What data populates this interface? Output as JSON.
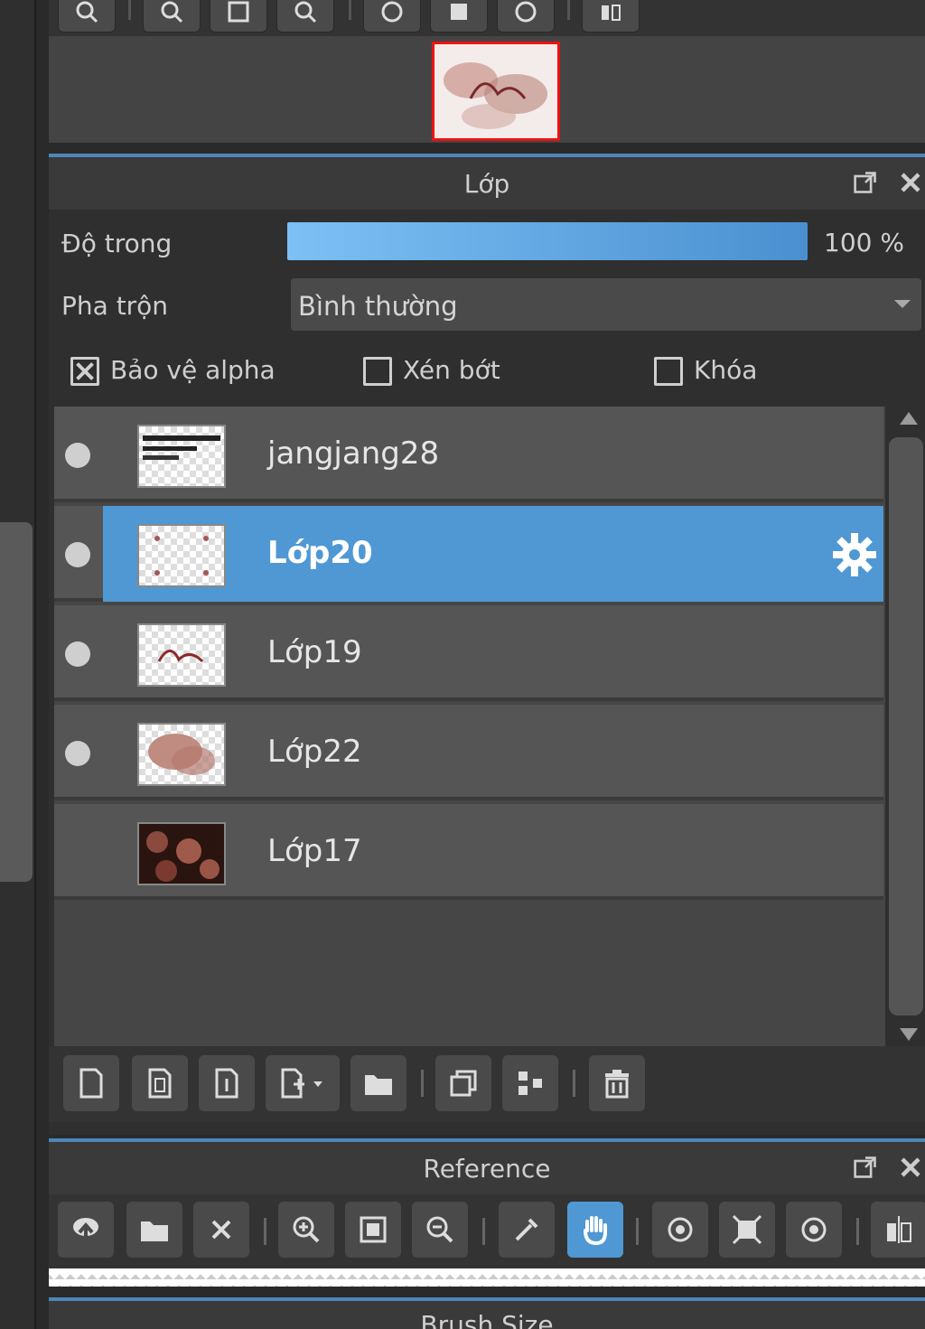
{
  "layer_panel": {
    "title": "Lớp",
    "opacity_label": "Độ trong",
    "opacity_value": "100 %",
    "opacity_fraction": 1.0,
    "blend_label": "Pha trộn",
    "blend_value": "Bình thường",
    "protect_alpha_label": "Bảo vệ alpha",
    "protect_alpha_checked": true,
    "clipping_label": "Xén bớt",
    "clipping_checked": false,
    "lock_label": "Khóa",
    "lock_checked": false,
    "layers": [
      {
        "name": "jangjang28",
        "visible": true,
        "selected": false
      },
      {
        "name": "Lớp20",
        "visible": true,
        "selected": true
      },
      {
        "name": "Lớp19",
        "visible": true,
        "selected": false
      },
      {
        "name": "Lớp22",
        "visible": true,
        "selected": false
      },
      {
        "name": "Lớp17",
        "visible": false,
        "selected": false
      }
    ]
  },
  "reference_panel": {
    "title": "Reference",
    "active_tool": "hand-icon"
  },
  "brush_panel": {
    "title": "Brush Size"
  },
  "colors": {
    "accent": "#4f98d3",
    "navigator_border": "#ee1111"
  }
}
